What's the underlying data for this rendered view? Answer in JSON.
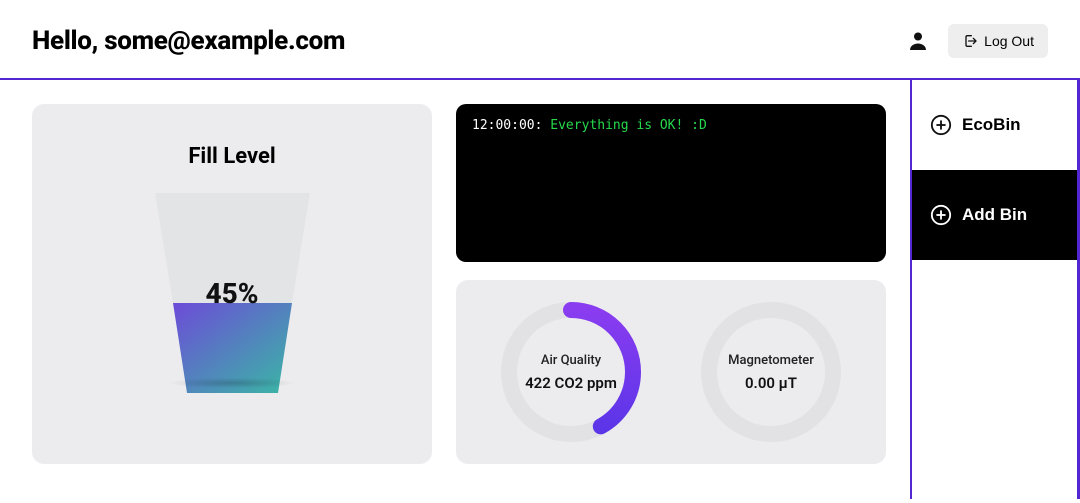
{
  "header": {
    "greeting_prefix": "Hello, ",
    "email": "some@example.com",
    "logout_label": "Log Out"
  },
  "fill_level": {
    "title": "Fill Level",
    "percent_label": "45%",
    "percent_value": 45
  },
  "console": {
    "time": "12:00:00:",
    "message": "Everything is OK! :D"
  },
  "gauges": {
    "air_quality": {
      "label": "Air Quality",
      "value_text": "422 CO2 ppm",
      "fraction": 0.42
    },
    "magnetometer": {
      "label": "Magnetometer",
      "value_text": "0.00 µT",
      "fraction": 0.0
    }
  },
  "sidebar": {
    "items": [
      {
        "label": "EcoBin"
      },
      {
        "label": "Add Bin"
      }
    ]
  }
}
